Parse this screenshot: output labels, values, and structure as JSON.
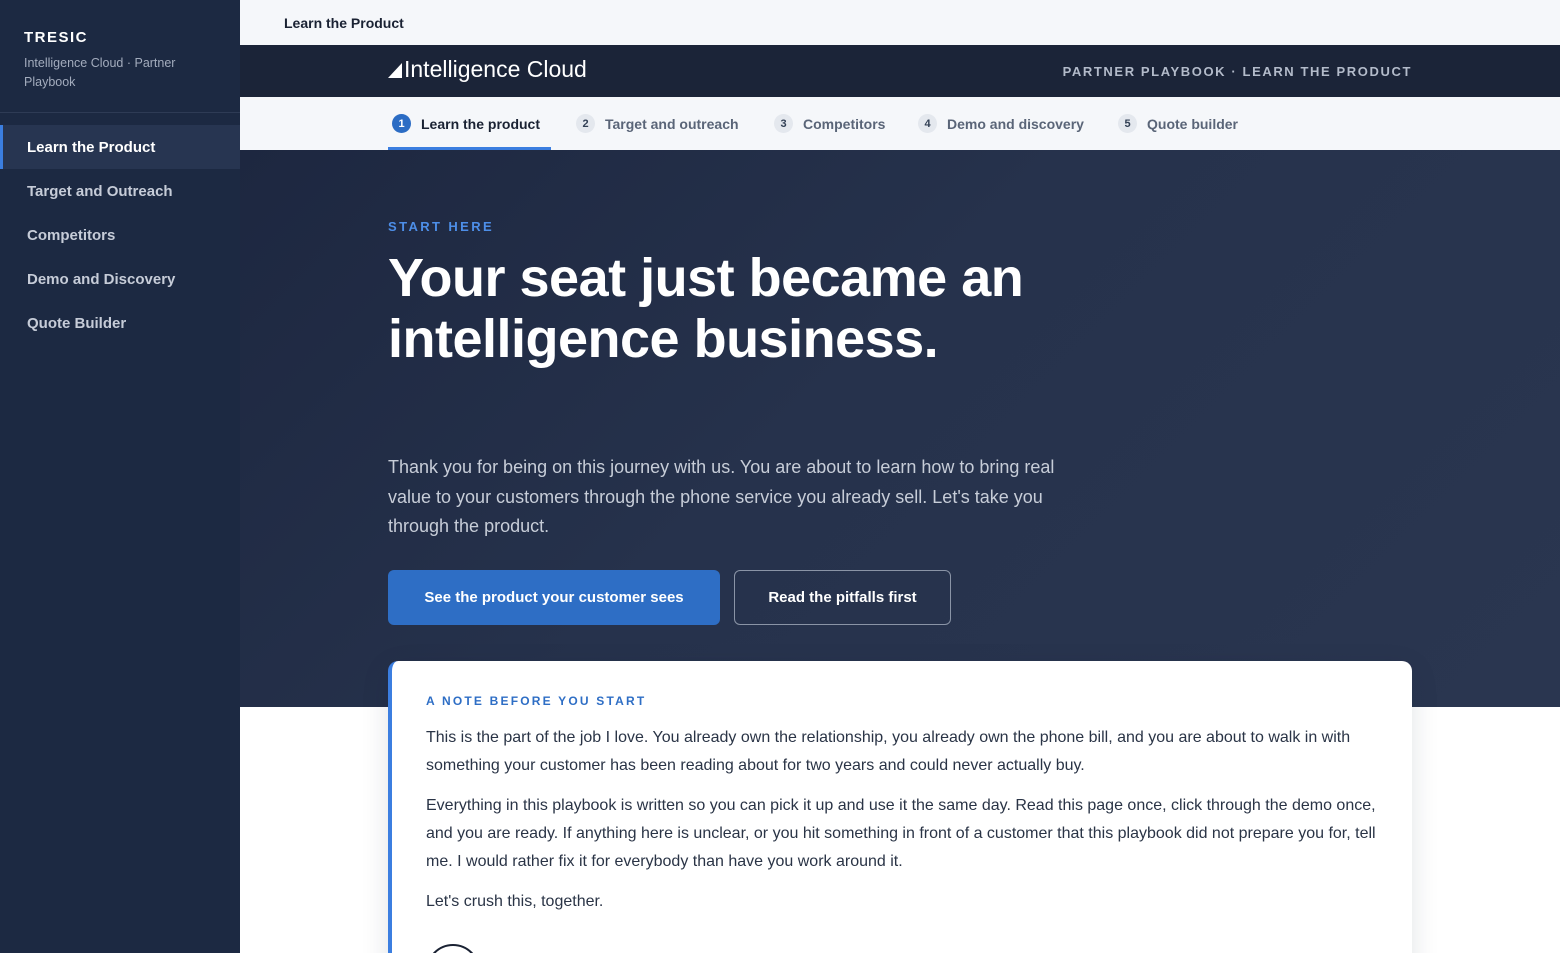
{
  "sidebar": {
    "brand": "TRESIC",
    "subtitle": "Intelligence Cloud · Partner Playbook",
    "items": [
      {
        "label": "Learn the Product"
      },
      {
        "label": "Target and Outreach"
      },
      {
        "label": "Competitors"
      },
      {
        "label": "Demo and Discovery"
      },
      {
        "label": "Quote Builder"
      }
    ]
  },
  "topbar": {
    "title": "Learn the Product"
  },
  "header": {
    "logo_text": "Intelligence Cloud",
    "right_label": "PARTNER PLAYBOOK · LEARN THE PRODUCT"
  },
  "steps": [
    {
      "num": "1",
      "label": "Learn the product"
    },
    {
      "num": "2",
      "label": "Target and outreach"
    },
    {
      "num": "3",
      "label": "Competitors"
    },
    {
      "num": "4",
      "label": "Demo and discovery"
    },
    {
      "num": "5",
      "label": "Quote builder"
    }
  ],
  "hero": {
    "eyebrow": "START HERE",
    "headline": "Your seat just became an intelligence business.",
    "lede": "Thank you for being on this journey with us. You are about to learn how to bring real value to your customers through the phone service you already sell. Let's take you through the product.",
    "primary_button": "See the product your customer sees",
    "secondary_button": "Read the pitfalls first"
  },
  "note": {
    "eyebrow": "A NOTE BEFORE YOU START",
    "paragraphs": [
      "This is the part of the job I love. You already own the relationship, you already own the phone bill, and you are about to walk in with something your customer has been reading about for two years and could never actually buy.",
      "Everything in this playbook is written so you can pick it up and use it the same day. Read this page once, click through the demo once, and you are ready. If anything here is unclear, or you hit something in front of a customer that this playbook did not prepare you for, tell me. I would rather fix it for everybody than have you work around it.",
      "Let's crush this, together."
    ]
  },
  "colors": {
    "sidebar_bg": "#1c2942",
    "accent": "#3b7ee0",
    "primary_button": "#2e6ec5",
    "hero_bg": "#222d46"
  }
}
